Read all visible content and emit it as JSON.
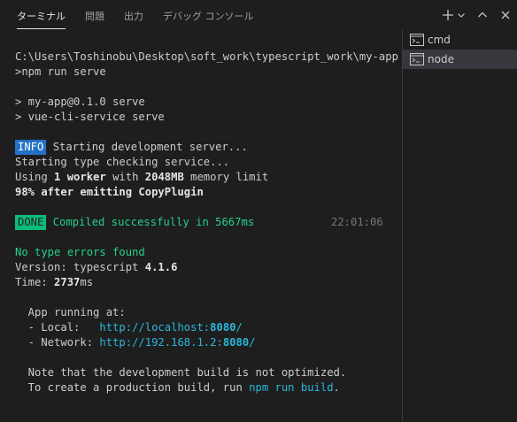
{
  "tabs": [
    {
      "label": "ターミナル",
      "active": true
    },
    {
      "label": "問題",
      "active": false
    },
    {
      "label": "出力",
      "active": false
    },
    {
      "label": "デバッグ コンソール",
      "active": false
    }
  ],
  "actions": {
    "new_terminal_icon": "plus-icon",
    "launch_profile_icon": "chevron-down-icon",
    "maximize_icon": "chevron-up-icon",
    "close_icon": "close-icon"
  },
  "terminal": {
    "path_line": "C:\\Users\\Toshinobu\\Desktop\\soft_work\\typescript_work\\my-app",
    "command_line": ">npm run serve",
    "serve_line_1": "> my-app@0.1.0 serve",
    "serve_line_2": "> vue-cli-service serve",
    "info_badge": "INFO",
    "info_text": " Starting development server...",
    "type_check": "Starting type checking service...",
    "using_prefix": "Using ",
    "using_workers": "1 worker",
    "using_middle": " with ",
    "using_memory": "2048MB",
    "using_suffix": " memory limit",
    "progress": "98% after emitting CopyPlugin",
    "done_badge": "DONE",
    "done_text": " Compiled successfully in 5667ms",
    "done_time": "22:01:06",
    "no_errors": "No type errors found",
    "version_label": "Version: typescript ",
    "version_value": "4.1.6",
    "time_label": "Time: ",
    "time_value": "2737",
    "time_unit": "ms",
    "app_running": "  App running at:",
    "local_label": "  - Local:   ",
    "local_url_pre": "http://localhost:",
    "local_port": "8080",
    "local_url_post": "/",
    "network_label": "  - Network: ",
    "network_url_pre": "http://192.168.1.2:",
    "network_port": "8080",
    "network_url_post": "/",
    "note_line": "  Note that the development build is not optimized.",
    "prod_prefix": "  To create a production build, run ",
    "prod_command": "npm run build",
    "prod_suffix": "."
  },
  "side_list": [
    {
      "label": "cmd",
      "icon": "terminal-icon",
      "selected": false
    },
    {
      "label": "node",
      "icon": "terminal-icon",
      "selected": true
    }
  ],
  "colors": {
    "background": "#1e1e1e",
    "text": "#cccccc",
    "green": "#23d18b",
    "cyan": "#29b8db",
    "info_badge": "#2472c8",
    "done_badge": "#0dbc79",
    "selected_item": "#37373d"
  }
}
